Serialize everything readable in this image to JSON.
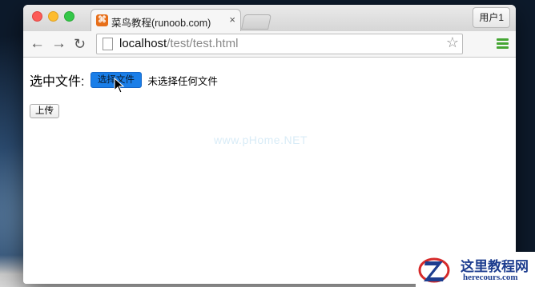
{
  "browser": {
    "tab_title": "菜鸟教程(runoob.com)",
    "tab_close": "×",
    "user_button": "用户1",
    "url_host": "localhost",
    "url_path": "/test/test.html"
  },
  "page": {
    "field_label": "选中文件:",
    "choose_button": "选择文件",
    "no_file_text": "未选择任何文件",
    "upload_button": "上传",
    "watermark": "www.pHome.NET"
  },
  "brand": {
    "logo_text": "这里教程网",
    "logo_url": "herecours.com"
  },
  "colors": {
    "choose_button_bg": "#1a7ee8",
    "menu_icon": "#45a633",
    "logo_blue": "#1d3d8f",
    "logo_red": "#d62a2a"
  }
}
